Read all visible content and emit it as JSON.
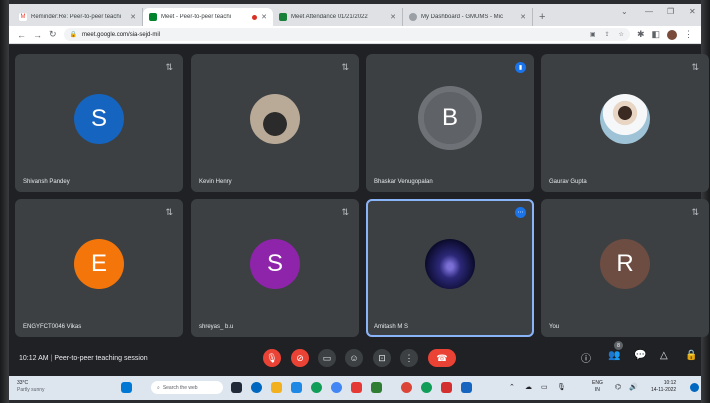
{
  "tabs": [
    {
      "label": "Reminder:Re: Peer-to-peer teachi",
      "color": "#ffffff"
    },
    {
      "label": "Meet - Peer-to-peer teachi",
      "color": "#00832d",
      "active": true
    },
    {
      "label": "Meet Attendance 01/21/2022",
      "color": "#188038"
    },
    {
      "label": "My Dashboard - GMUMS - Mic",
      "color": "#5f6368"
    }
  ],
  "url": "meet.google.com/sia-sejd-mil",
  "participants": [
    {
      "name": "Shivansh Pandey",
      "initial": "S",
      "color": "#1565c0",
      "type": "letter"
    },
    {
      "name": "Kevin Henry",
      "initial": "",
      "color": "#c9b8a8",
      "type": "photo-moto"
    },
    {
      "name": "Bhaskar Venugopalan",
      "initial": "B",
      "color": "#5f6368",
      "type": "big"
    },
    {
      "name": "Gaurav Gupta",
      "initial": "",
      "color": "#d8e4ec",
      "type": "photo-person"
    },
    {
      "name": "ENGYFCT0046 Vikas",
      "initial": "E",
      "color": "#f4760b",
      "type": "letter"
    },
    {
      "name": "shreyas_ b.u",
      "initial": "S",
      "color": "#8e24aa",
      "type": "letter"
    },
    {
      "name": "Amitash M S",
      "initial": "",
      "color": "#1a1a4e",
      "type": "photo-galaxy"
    },
    {
      "name": "You",
      "initial": "R",
      "color": "#6d4c41",
      "type": "letter"
    }
  ],
  "meeting": {
    "time": "10:12 AM",
    "separator": "|",
    "title": "Peer-to-peer teaching session",
    "people_count": "8"
  },
  "taskbar": {
    "weather_temp": "33°C",
    "weather_desc": "Partly sunny",
    "search": "Search the web",
    "lang": "ENG",
    "lang2": "IN",
    "time": "10:12",
    "date": "14-11-2022"
  }
}
